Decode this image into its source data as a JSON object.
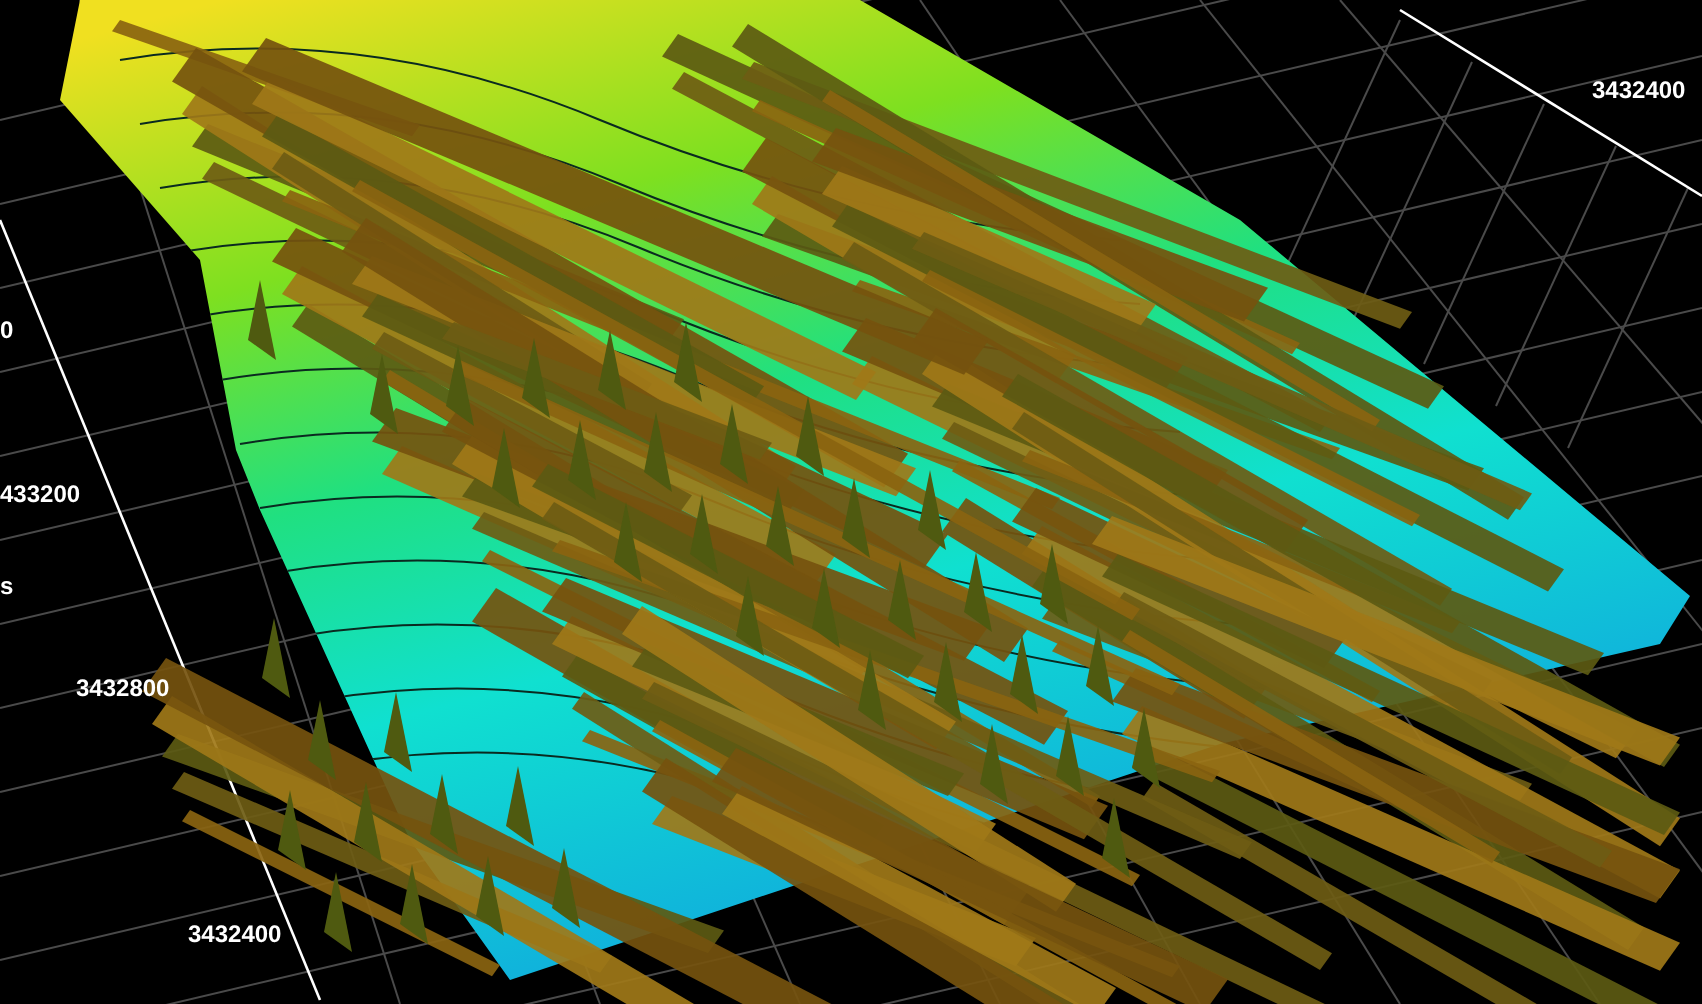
{
  "axis_labels": [
    {
      "text": "3432400"
    },
    {
      "text": "0"
    },
    {
      "text": "433200"
    },
    {
      "text": "s"
    },
    {
      "text": "3432800"
    },
    {
      "text": "3432400"
    }
  ]
}
